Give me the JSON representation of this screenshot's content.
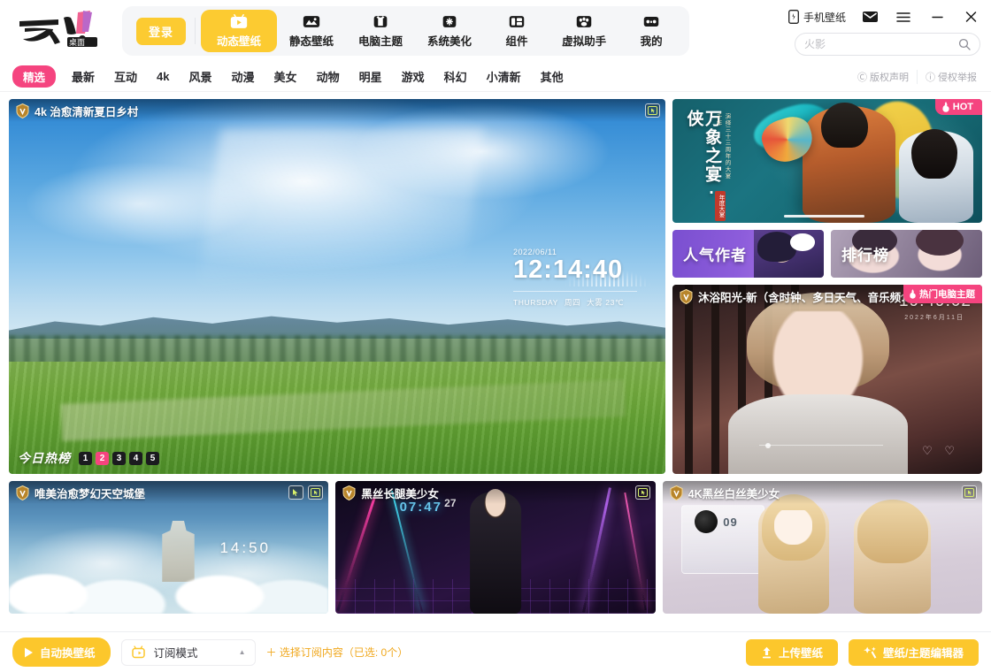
{
  "app": {
    "brand_name": "元气桌面",
    "accent_yellow": "#fccb31",
    "accent_pink": "#f5447f"
  },
  "topbar": {
    "login_label": "登录",
    "nav_items": [
      {
        "label": "动态壁纸",
        "icon": "dynamic-wallpaper-icon",
        "active": true
      },
      {
        "label": "静态壁纸",
        "icon": "static-wallpaper-icon",
        "active": false
      },
      {
        "label": "电脑主题",
        "icon": "pc-theme-icon",
        "active": false
      },
      {
        "label": "系统美化",
        "icon": "system-beautify-icon",
        "active": false
      },
      {
        "label": "组件",
        "icon": "widget-icon",
        "active": false
      },
      {
        "label": "虚拟助手",
        "icon": "virtual-assistant-icon",
        "active": false
      },
      {
        "label": "我的",
        "icon": "my-icon",
        "active": false
      }
    ],
    "phone_wallpaper_label": "手机壁纸",
    "window_controls": {
      "mail": "mail-icon",
      "menu": "hamburger-menu-icon",
      "minimize": "minimize-icon",
      "close": "close-icon"
    },
    "search": {
      "placeholder": "火影",
      "value": "",
      "icon": "search-icon"
    }
  },
  "categories": {
    "items": [
      {
        "label": "精选",
        "active": true
      },
      {
        "label": "最新",
        "active": false
      },
      {
        "label": "互动",
        "active": false
      },
      {
        "label": "4k",
        "active": false
      },
      {
        "label": "风景",
        "active": false
      },
      {
        "label": "动漫",
        "active": false
      },
      {
        "label": "美女",
        "active": false
      },
      {
        "label": "动物",
        "active": false
      },
      {
        "label": "明星",
        "active": false
      },
      {
        "label": "游戏",
        "active": false
      },
      {
        "label": "科幻",
        "active": false
      },
      {
        "label": "小清新",
        "active": false
      },
      {
        "label": "其他",
        "active": false
      }
    ],
    "copyright_label": "版权声明",
    "copyright_icon": "copyright-icon",
    "report_label": "侵权举报",
    "report_icon": "info-icon"
  },
  "hero": {
    "title": "4k 治愈清新夏日乡村",
    "badge": "v-badge-icon",
    "corner_icon": "interactive-wallpaper-icon",
    "clock": {
      "date": "2022/06/11",
      "time": "12:14:40",
      "weekday_en": "THURSDAY",
      "weekday_cn": "周四",
      "weather": "大雾 23℃"
    },
    "hot_rank_label": "今日热榜",
    "pages": [
      {
        "num": "1",
        "active": false
      },
      {
        "num": "2",
        "active": true
      },
      {
        "num": "3",
        "active": false
      },
      {
        "num": "4",
        "active": false
      },
      {
        "num": "5",
        "active": false
      }
    ]
  },
  "promo_top": {
    "title": "万象之宴·侠",
    "subtitle": "演绎三十三周年的大宴千年",
    "tag": "年度大宴",
    "hot_badge": "HOT",
    "hot_icon": "flame-icon"
  },
  "mini_cards": [
    {
      "label": "人气作者",
      "name": "popular-authors-card"
    },
    {
      "label": "排行榜",
      "name": "ranking-card"
    }
  ],
  "promo_bottom": {
    "title": "沐浴阳光-新（含时钟、多日天气、音乐频…",
    "badge": "v-badge-icon",
    "hot_badge": "热门电脑主题",
    "hot_icon": "flame-icon",
    "time": "19:49:02",
    "date_sub": "2022年6月11日"
  },
  "bottom_cards": [
    {
      "title": "唯美治愈梦幻天空城堡",
      "badge": "v-badge-icon",
      "icons": [
        "mouse-interactive-icon",
        "interactive-wallpaper-icon"
      ],
      "time": "14:50"
    },
    {
      "title": "黑丝长腿美少女",
      "badge": "v-badge-icon",
      "icons": [
        "interactive-wallpaper-icon"
      ],
      "time": "07:47",
      "seconds": "27"
    },
    {
      "title": "4K黑丝白丝美少女",
      "badge": "v-badge-icon",
      "icons": [
        "interactive-wallpaper-icon"
      ],
      "time": "09"
    }
  ],
  "bottombar": {
    "auto_change_label": "自动换壁纸",
    "auto_change_icon": "play-icon",
    "subscribe_mode_label": "订阅模式",
    "subscribe_mode_icon": "tv-icon",
    "subscribe_caret": "▲",
    "pick_content_label": "＋ 选择订阅内容（已选: 0个）",
    "upload_label": "上传壁纸",
    "upload_icon": "upload-icon",
    "editor_label": "壁纸/主题编辑器",
    "editor_icon": "magic-wand-icon"
  }
}
